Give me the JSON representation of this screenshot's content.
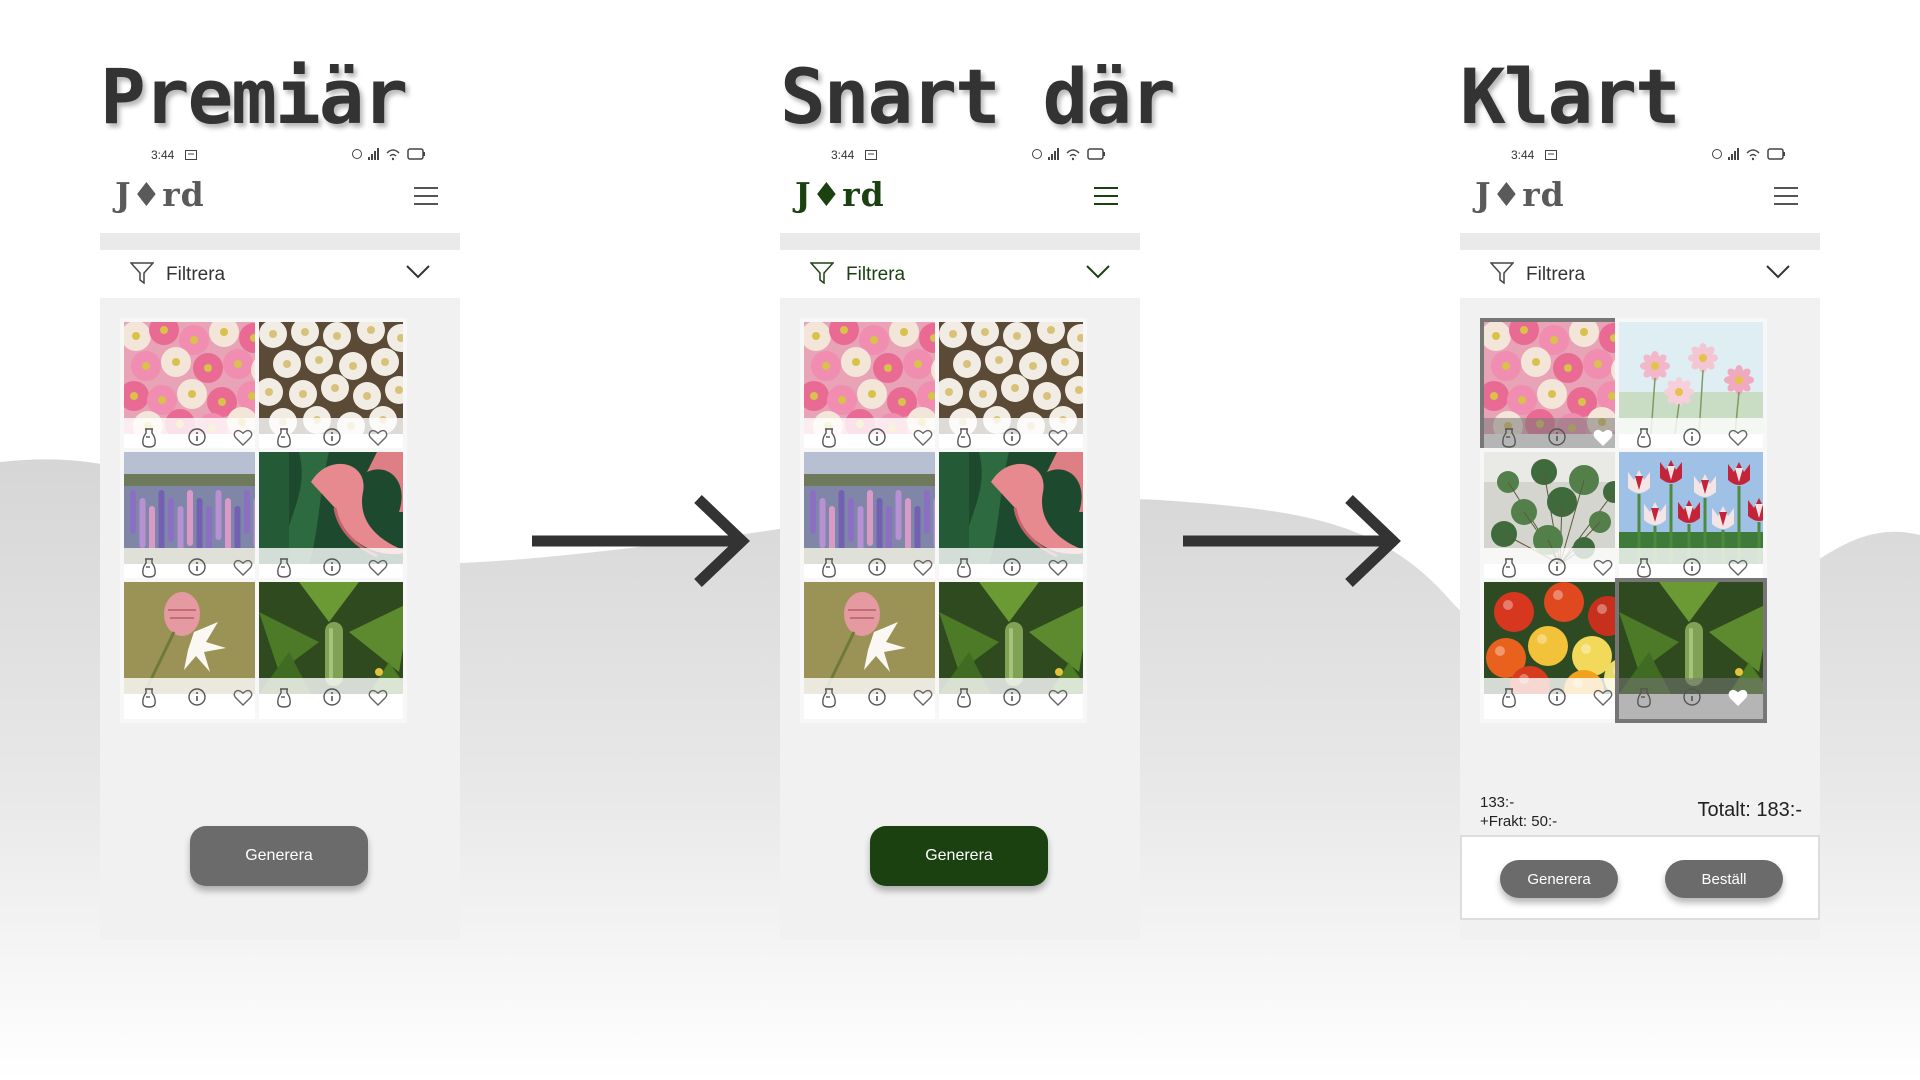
{
  "colors": {
    "brand_green": "#1c4111",
    "button_gray": "#6b6b6b",
    "heading": "#333333",
    "screen_bg": "#f1f1f1",
    "hills": "#dadada"
  },
  "arrows": [
    "arrow-right-icon",
    "arrow-right-icon"
  ],
  "screens": [
    {
      "heading": "Premiär",
      "status": {
        "time": "3:44"
      },
      "logo": "J♦rd",
      "filter_label": "Filtrera",
      "button_label": "Generera",
      "cards": [
        {
          "image": "pink-white-flowers",
          "icons": [
            "seed-bag-icon",
            "info-icon",
            "heart-icon"
          ]
        },
        {
          "image": "white-daisies",
          "icons": [
            "seed-bag-icon",
            "info-icon",
            "heart-icon"
          ]
        },
        {
          "image": "lupine-field",
          "icons": [
            "seed-bag-icon",
            "info-icon",
            "heart-icon"
          ]
        },
        {
          "image": "calla-lily",
          "icons": [
            "seed-bag-icon",
            "info-icon",
            "heart-icon"
          ]
        },
        {
          "image": "campion-flower",
          "icons": [
            "seed-bag-icon",
            "info-icon",
            "heart-icon"
          ]
        },
        {
          "image": "cucumber-plant",
          "icons": [
            "seed-bag-icon",
            "info-icon",
            "heart-icon"
          ]
        }
      ]
    },
    {
      "heading": "Snart där",
      "status": {
        "time": "3:44"
      },
      "logo": "J♦rd",
      "filter_label": "Filtrera",
      "button_label": "Generera",
      "cards": [
        {
          "image": "pink-white-flowers",
          "icons": [
            "seed-bag-icon",
            "info-icon",
            "heart-icon"
          ]
        },
        {
          "image": "white-daisies",
          "icons": [
            "seed-bag-icon",
            "info-icon",
            "heart-icon"
          ]
        },
        {
          "image": "lupine-field",
          "icons": [
            "seed-bag-icon",
            "info-icon",
            "heart-icon"
          ]
        },
        {
          "image": "calla-lily",
          "icons": [
            "seed-bag-icon",
            "info-icon",
            "heart-icon"
          ]
        },
        {
          "image": "campion-flower",
          "icons": [
            "seed-bag-icon",
            "info-icon",
            "heart-icon"
          ]
        },
        {
          "image": "cucumber-plant",
          "icons": [
            "seed-bag-icon",
            "info-icon",
            "heart-icon"
          ]
        }
      ]
    },
    {
      "heading": "Klart",
      "status": {
        "time": "3:44"
      },
      "logo": "J♦rd",
      "filter_label": "Filtrera",
      "price": "133:-",
      "shipping": "+Frakt: 50:-",
      "total": "Totalt: 183:-",
      "generate_label": "Generera",
      "order_label": "Beställ",
      "cards": [
        {
          "image": "pink-white-flowers",
          "selected": true,
          "icons": [
            "seed-bag-icon",
            "info-icon",
            "heart-icon"
          ]
        },
        {
          "image": "cosmos-flowers",
          "selected": false,
          "icons": [
            "seed-bag-icon",
            "info-icon",
            "heart-icon"
          ]
        },
        {
          "image": "pilea-plant",
          "selected": false,
          "icons": [
            "seed-bag-icon",
            "info-icon",
            "heart-icon"
          ]
        },
        {
          "image": "red-white-tulips",
          "selected": false,
          "icons": [
            "seed-bag-icon",
            "info-icon",
            "heart-icon"
          ]
        },
        {
          "image": "tomatoes",
          "selected": false,
          "icons": [
            "seed-bag-icon",
            "info-icon",
            "heart-icon"
          ]
        },
        {
          "image": "cucumber-plant",
          "selected": true,
          "icons": [
            "seed-bag-icon",
            "info-icon",
            "heart-icon"
          ]
        }
      ]
    }
  ]
}
